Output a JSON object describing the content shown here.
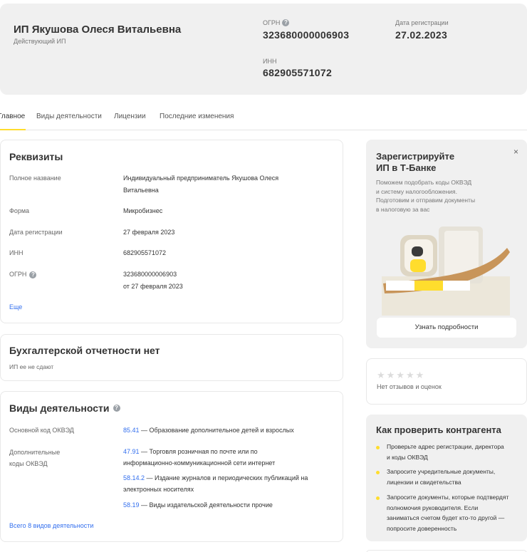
{
  "header": {
    "company_name": "ИП Якушова Олеся Витальевна",
    "status": "Действующий ИП",
    "ogrn_label": "ОГРН",
    "ogrn_value": "323680000006903",
    "reg_date_label": "Дата регистрации",
    "reg_date_value": "27.02.2023",
    "inn_label": "ИНН",
    "inn_value": "682905571072"
  },
  "tabs": [
    {
      "label": "Главное",
      "active": true
    },
    {
      "label": "Виды деятельности",
      "active": false
    },
    {
      "label": "Лицензии",
      "active": false
    },
    {
      "label": "Последние изменения",
      "active": false
    }
  ],
  "requisites": {
    "title": "Реквизиты",
    "rows": [
      {
        "label": "Полное название",
        "value_1": "Индивидуальный предприниматель Якушова Олеся",
        "value_2": "Витальевна"
      },
      {
        "label": "Форма",
        "value_1": "Микробизнес"
      },
      {
        "label": "Дата регистрации",
        "value_1": "27 февраля 2023"
      },
      {
        "label": "ИНН",
        "value_1": "682905571072"
      },
      {
        "label": "ОГРН",
        "value_1": "323680000006903",
        "value_2": "от 27 февраля 2023"
      }
    ],
    "more_link": "Еще"
  },
  "accounting": {
    "title": "Бухгалтерской отчетности нет",
    "subtitle": "ИП ее не сдают"
  },
  "activities": {
    "title": "Виды деятельности",
    "main_label": "Основной код ОКВЭД",
    "main_code": "85.41",
    "main_text": " — Образование дополнительное детей и взрослых",
    "additional_label_1": "Дополнительные",
    "additional_label_2": "коды ОКВЭД",
    "additional": [
      {
        "code": "47.91",
        "line_1": " — Торговля розничная по почте или по",
        "line_2": "информационно-коммуникационной сети интернет"
      },
      {
        "code": "58.14.2",
        "line_1": " — Издание журналов и периодических публикаций на",
        "line_2": "электронных носителях"
      },
      {
        "code": "58.19",
        "line_1": " — Виды издательской деятельности прочие"
      }
    ],
    "all_link": "Всего 8 видов деятельности"
  },
  "promo": {
    "title_1": "Зарегистрируйте",
    "title_2": "ИП в Т-Банке",
    "text_1": "Поможем подобрать коды ОКВЭД",
    "text_2": "и систему налогообложения.",
    "text_3": "Подготовим и отправим документы",
    "text_4": "в налоговую за вас",
    "cta": "Узнать подробности",
    "close": "×"
  },
  "reviews": {
    "stars": "★★★★★",
    "text": "Нет отзывов и оценок"
  },
  "check": {
    "title": "Как проверить контрагента",
    "items": [
      {
        "line_1": "Проверьте адрес регистрации, директора",
        "line_2": "и коды ОКВЭД"
      },
      {
        "line_1": "Запросите учредительные документы,",
        "line_2": "лицензии и свидетельства"
      },
      {
        "line_1": "Запросите документы, которые подтвердят",
        "line_2": "полномочия руководителя. Если",
        "line_3": "заниматься счетом будет кто-то другой —",
        "line_4": "попросите доверенность"
      }
    ]
  },
  "colors": {
    "accent": "#ffdd2d",
    "link": "#336fee",
    "panel": "#f0f0f0"
  }
}
